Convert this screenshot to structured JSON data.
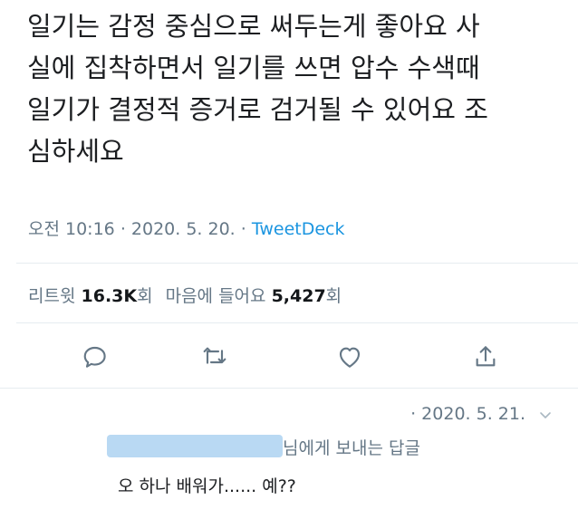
{
  "tweet": {
    "lines": [
      "일기는 감정 중심으로 써두는게 좋아요 사",
      "실에 집착하면서 일기를 쓰면 압수 수색때",
      "일기가 결정적 증거로 검거될 수 있어요 조",
      "심하세요"
    ],
    "time": "오전 10:16",
    "separator": "·",
    "date": "2020. 5. 20.",
    "source": "TweetDeck"
  },
  "stats": {
    "retweets_label": "리트윗",
    "retweets_count": "16.3K",
    "retweets_unit": "회",
    "likes_label": "마음에 들어요",
    "likes_count": "5,427",
    "likes_unit": "회"
  },
  "actions": {
    "icons": [
      "reply-icon",
      "retweet-icon",
      "like-icon",
      "share-icon"
    ]
  },
  "reply": {
    "date": "· 2020. 5. 21.",
    "reply_to_suffix": "님에게 보내는 답글",
    "text": "오 하나 배워가...... 예??"
  },
  "colors": {
    "link": "#1b95e0",
    "muted": "#657786",
    "icon": "#657786",
    "divider": "#e6ecf0",
    "redaction": "#b9d9f3"
  }
}
